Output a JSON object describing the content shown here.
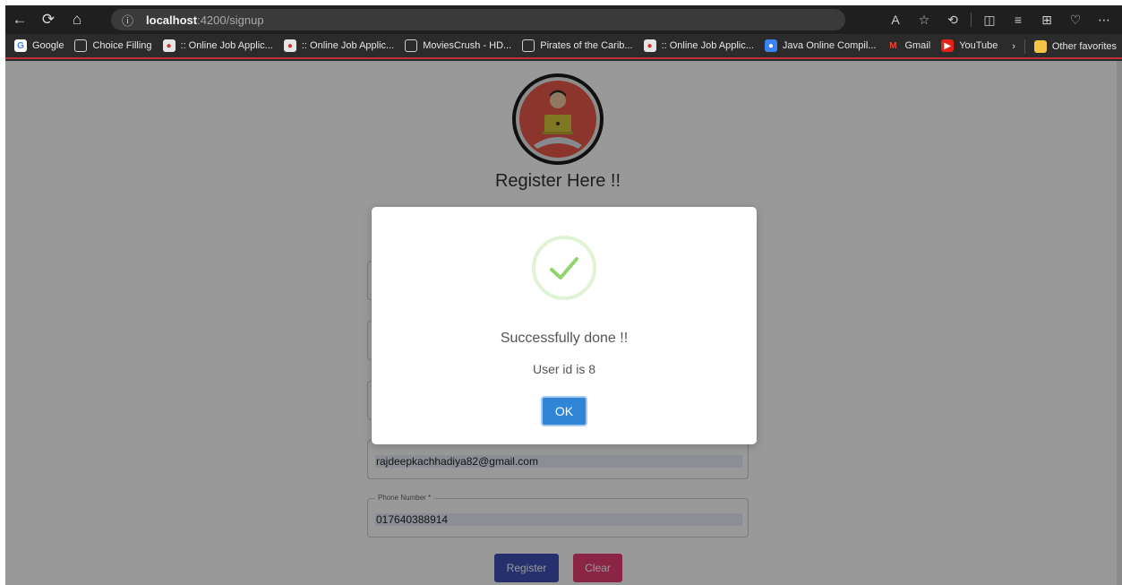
{
  "browser": {
    "url_host": "localhost",
    "url_path": ":4200/signup",
    "bookmarks": [
      {
        "label": "Google",
        "icon": "google-icon"
      },
      {
        "label": "Choice Filling",
        "icon": "page-icon"
      },
      {
        "label": ":: Online Job Applic...",
        "icon": "logo-icon"
      },
      {
        "label": ":: Online Job Applic...",
        "icon": "logo-icon"
      },
      {
        "label": "MoviesCrush - HD...",
        "icon": "page-icon"
      },
      {
        "label": "Pirates of the Carib...",
        "icon": "page-icon"
      },
      {
        "label": ":: Online Job Applic...",
        "icon": "logo-icon"
      },
      {
        "label": "Java Online Compil...",
        "icon": "java-icon"
      },
      {
        "label": "Gmail",
        "icon": "gmail-icon"
      },
      {
        "label": "YouTube",
        "icon": "youtube-icon"
      }
    ],
    "other_favorites": "Other favorites"
  },
  "form": {
    "title": "Register Here !!",
    "email_value": "rajdeepkachhadiya82@gmail.com",
    "phone_label": "Phone Number *",
    "phone_value": "017640388914",
    "register_label": "Register",
    "clear_label": "Clear",
    "accent_color": "#3f51b5",
    "clear_color": "#e83e75"
  },
  "dialog": {
    "title": "Successfully done !!",
    "text": "User id is 8",
    "ok_label": "OK",
    "ok_color": "#3085d6",
    "icon": "success-check-icon"
  }
}
